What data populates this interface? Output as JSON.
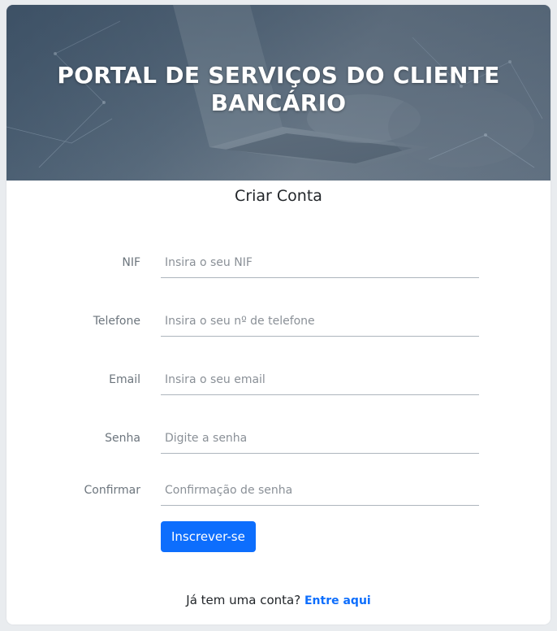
{
  "header": {
    "title": "PORTAL DE SERVIÇOS DO CLIENTE BANCÁRIO"
  },
  "form": {
    "title": "Criar Conta",
    "fields": [
      {
        "label": "NIF",
        "placeholder": "Insira o seu NIF",
        "value": ""
      },
      {
        "label": "Telefone",
        "placeholder": "Insira o seu nº de telefone",
        "value": ""
      },
      {
        "label": "Email",
        "placeholder": "Insira o seu email",
        "value": ""
      },
      {
        "label": "Senha",
        "placeholder": "Digite a senha",
        "value": ""
      },
      {
        "label": "Confirmar",
        "placeholder": "Confirmação de senha",
        "value": ""
      }
    ],
    "submit_label": "Inscrever-se"
  },
  "footer": {
    "text": "Já tem uma conta?",
    "link_label": "Entre aqui"
  },
  "colors": {
    "primary": "#0d6efd",
    "page_background": "#e9ecef",
    "card_background": "#ffffff"
  }
}
